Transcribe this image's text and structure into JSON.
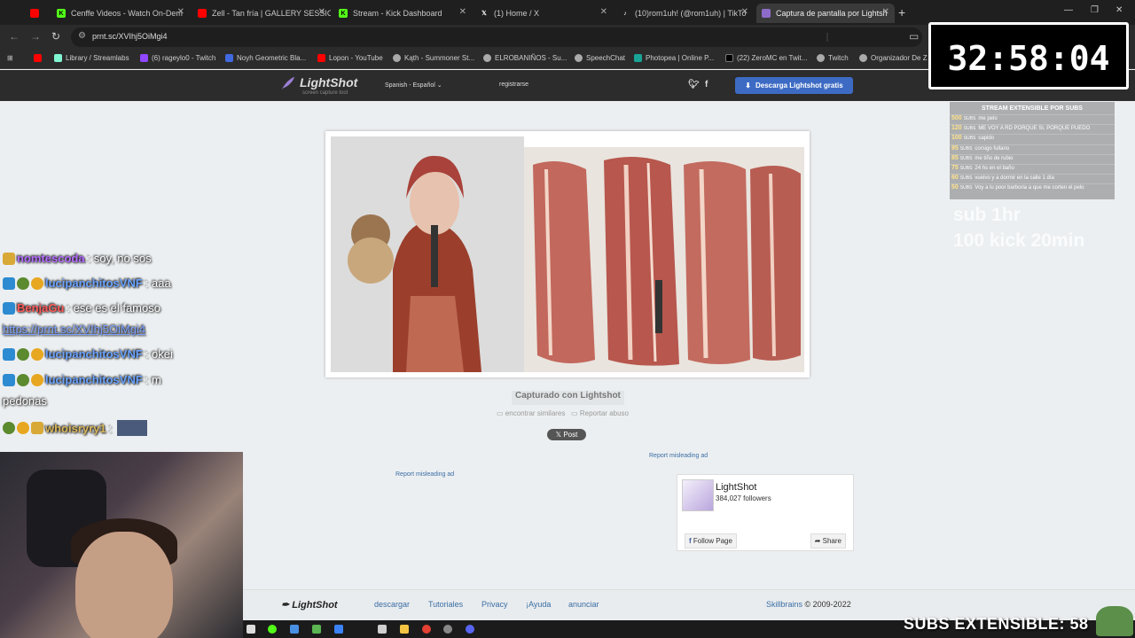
{
  "browser": {
    "tabs": [
      {
        "label": "",
        "color": "#ff0000"
      },
      {
        "label": "Cenffe Videos - Watch On-Dem",
        "color": "#53fc18"
      },
      {
        "label": "Zell - Tan fría | GALLERY SESSIO",
        "color": "#ff0000"
      },
      {
        "label": "Stream - Kick Dashboard",
        "color": "#53fc18"
      },
      {
        "label": "(1) Home / X",
        "color": "#000000"
      },
      {
        "label": "(10)rom1uh! (@rom1uh) | TikTo",
        "color": "#111111"
      },
      {
        "label": "Captura de pantalla por Lightsh",
        "color": "#8d6cc9"
      }
    ],
    "url": "prnt.sc/XVIhj5OiMgi4",
    "bookmarks": [
      {
        "label": "",
        "color": "#ff0000"
      },
      {
        "label": "Library / Streamlabs",
        "color": "#80f5d2"
      },
      {
        "label": "(6) rageylo0 - Twitch",
        "color": "#9146ff"
      },
      {
        "label": "Noyh Geometric Bla...",
        "color": "#4169e1"
      },
      {
        "label": "Lopon - YouTube",
        "color": "#ff0000"
      },
      {
        "label": "Kąth - Summoner St...",
        "color": "#aaaaaa"
      },
      {
        "label": "ELROBANIÑOS - Su...",
        "color": "#aaaaaa"
      },
      {
        "label": "SpeechChat",
        "color": "#aaaaaa"
      },
      {
        "label": "Photopea | Online P...",
        "color": "#18a497"
      },
      {
        "label": "(22) ZeroMC en Twit...",
        "color": "#000000"
      },
      {
        "label": "Twitch",
        "color": "#aaaaaa"
      },
      {
        "label": "Organizador De Z",
        "color": "#aaaaaa"
      }
    ]
  },
  "lightshot": {
    "logo": "LightShot",
    "slogan": "screen capture tool",
    "language": "Spanish - Español",
    "register": "registrarse",
    "download_button": "Descarga Lightshot gratis",
    "captured_label": "Capturado con Lightshot",
    "find_similar": "encontrar similares",
    "report_abuse": "Reportar abuso",
    "post_button": "Post",
    "report_ad_1": "Report misleading ad",
    "report_ad_2": "Report misleading ad",
    "facebook": {
      "name": "LightShot",
      "followers": "384,027 followers",
      "follow": "Follow Page",
      "share": "Share"
    },
    "footer": {
      "logo": "LightShot",
      "links": [
        "descargar",
        "Tutoriales",
        "Privacy",
        "¡Ayuda",
        "anunciar"
      ],
      "company": "Skillbrains",
      "copyright": "© 2009-2022"
    }
  },
  "overlay": {
    "timer": "32:58:04",
    "subs_header": "STREAM EXTENSIBLE POR SUBS",
    "subs_goals": [
      {
        "count": "500",
        "unit": "SUBS",
        "text": "me pelo"
      },
      {
        "count": "120",
        "unit": "SUBS",
        "text": "ME VOY A RD PORQUE SI, PORQUE PUEDO"
      },
      {
        "count": "100",
        "unit": "SUBS",
        "text": "capido"
      },
      {
        "count": "95",
        "unit": "SUBS",
        "text": "corsigo fullano"
      },
      {
        "count": "85",
        "unit": "SUBS",
        "text": "me tiño de rubio"
      },
      {
        "count": "75",
        "unit": "SUBS",
        "text": "24 hs en el baño"
      },
      {
        "count": "60",
        "unit": "SUBS",
        "text": "vuelvo y a dormir en la calle 1 día"
      },
      {
        "count": "50",
        "unit": "SUBS",
        "text": "Voy a lu poor barboria a que me corten el pelo"
      }
    ],
    "sub_time": "sub 1hr",
    "kick_time": "100 kick 20min",
    "banner": "SUBS EXTENSIBLE: 58",
    "chat": [
      {
        "user": "nomtescoda",
        "msg": ": soy, no sos",
        "color": "#b36bff"
      },
      {
        "user": "lucipanchitosVNF",
        "msg": ": aaa",
        "color": "#6aa3ff"
      },
      {
        "user": "BenjaGu",
        "msg": ": ese es el famoso",
        "color": "#ff5a5a"
      },
      {
        "user": "",
        "msg": "https://prnt.sc/XVIhj5OiMgi4",
        "color": "#7aa0ff"
      },
      {
        "user": "lucipanchitosVNF",
        "msg": ": okei",
        "color": "#6aa3ff"
      },
      {
        "user": "lucipanchitosVNF",
        "msg": ": m",
        "color": "#6aa3ff"
      },
      {
        "user": "",
        "msg": "pedonas",
        "color": "#ffffff"
      },
      {
        "user": "whoisryry1",
        "msg": ":",
        "color": "#d8b65a"
      }
    ]
  }
}
